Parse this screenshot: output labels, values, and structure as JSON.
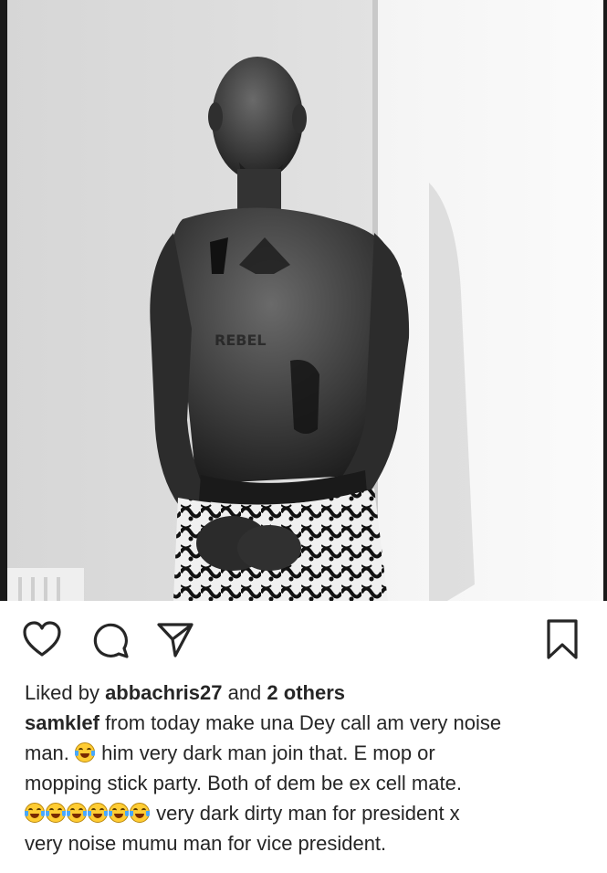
{
  "post": {
    "photo": {
      "icon": "photo-of-shirtless-man"
    },
    "actions": {
      "like_icon": "heart-icon",
      "comment_icon": "comment-icon",
      "share_icon": "send-icon",
      "save_icon": "bookmark-icon"
    },
    "likes": {
      "prefix": "Liked by ",
      "user": "abbachris27",
      "joiner": " and ",
      "others": "2 others"
    },
    "caption": {
      "username": "samklef",
      "line1": " from today make una Dey call am very noise",
      "line2a": "man. ",
      "line2b": " him very dark man join that. E mop or",
      "line3": "mopping stick party.  Both of dem be  ex cell mate.",
      "line4": " very dark dirty man for president x",
      "line5": "very noise mumu man for vice president.",
      "emoji_name": "face-with-tears-of-joy-emoji"
    },
    "colors": {
      "text": "#262626",
      "background": "#ffffff"
    }
  }
}
